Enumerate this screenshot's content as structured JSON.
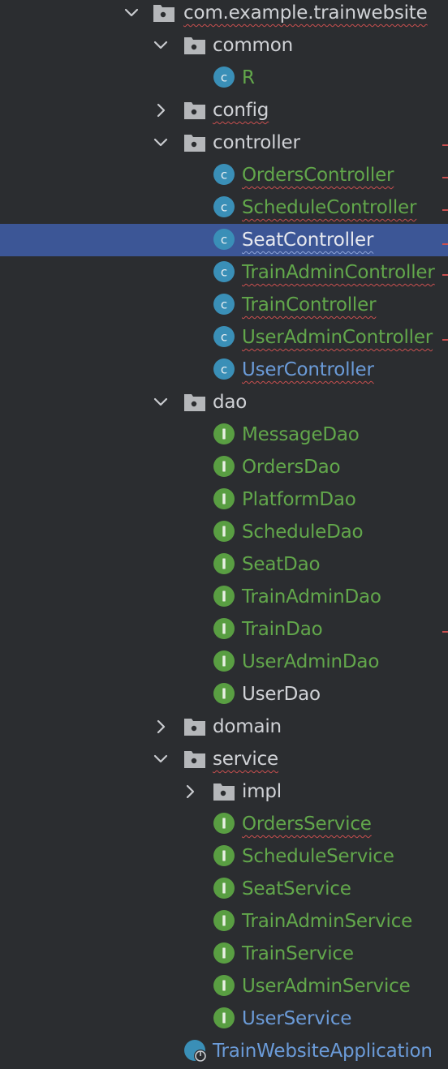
{
  "colors": {
    "background": "#2b2d30",
    "selection": "#3c5696",
    "text_default": "#d0d2d6",
    "text_modified": "#62a74b",
    "text_link": "#6b9bd8",
    "class_icon": "#3a8fb7",
    "interface_icon": "#599e42",
    "folder_icon": "#b5b7ba",
    "error_underline": "#c94f4f"
  },
  "tree": [
    {
      "label": "com.example.trainwebsite",
      "kind": "package",
      "expanded": true,
      "depth": 0,
      "color": "default",
      "underline": "error"
    },
    {
      "label": "common",
      "kind": "package",
      "expanded": true,
      "depth": 1,
      "color": "default"
    },
    {
      "label": "R",
      "kind": "class",
      "depth": 2,
      "color": "modified"
    },
    {
      "label": "config",
      "kind": "package",
      "expanded": false,
      "depth": 1,
      "color": "default",
      "underline": "error"
    },
    {
      "label": "controller",
      "kind": "package",
      "expanded": true,
      "depth": 1,
      "color": "default",
      "mark": true
    },
    {
      "label": "OrdersController",
      "kind": "class",
      "depth": 2,
      "color": "modified",
      "underline": "error",
      "mark": true
    },
    {
      "label": "ScheduleController",
      "kind": "class",
      "depth": 2,
      "color": "modified",
      "underline": "error",
      "mark": true
    },
    {
      "label": "SeatController",
      "kind": "class",
      "depth": 2,
      "color": "default",
      "underline": "selected",
      "selected": true,
      "mark": true
    },
    {
      "label": "TrainAdminController",
      "kind": "class",
      "depth": 2,
      "color": "modified",
      "underline": "error",
      "mark": true
    },
    {
      "label": "TrainController",
      "kind": "class",
      "depth": 2,
      "color": "modified",
      "underline": "error"
    },
    {
      "label": "UserAdminController",
      "kind": "class",
      "depth": 2,
      "color": "modified",
      "underline": "error",
      "mark": true
    },
    {
      "label": "UserController",
      "kind": "class",
      "depth": 2,
      "color": "link",
      "underline": "error"
    },
    {
      "label": "dao",
      "kind": "package",
      "expanded": true,
      "depth": 1,
      "color": "default"
    },
    {
      "label": "MessageDao",
      "kind": "interface",
      "depth": 2,
      "color": "modified"
    },
    {
      "label": "OrdersDao",
      "kind": "interface",
      "depth": 2,
      "color": "modified"
    },
    {
      "label": "PlatformDao",
      "kind": "interface",
      "depth": 2,
      "color": "modified"
    },
    {
      "label": "ScheduleDao",
      "kind": "interface",
      "depth": 2,
      "color": "modified"
    },
    {
      "label": "SeatDao",
      "kind": "interface",
      "depth": 2,
      "color": "modified"
    },
    {
      "label": "TrainAdminDao",
      "kind": "interface",
      "depth": 2,
      "color": "modified"
    },
    {
      "label": "TrainDao",
      "kind": "interface",
      "depth": 2,
      "color": "modified",
      "mark": true
    },
    {
      "label": "UserAdminDao",
      "kind": "interface",
      "depth": 2,
      "color": "modified"
    },
    {
      "label": "UserDao",
      "kind": "interface",
      "depth": 2,
      "color": "default"
    },
    {
      "label": "domain",
      "kind": "package",
      "expanded": false,
      "depth": 1,
      "color": "default"
    },
    {
      "label": "service",
      "kind": "package",
      "expanded": true,
      "depth": 1,
      "color": "default",
      "underline": "error"
    },
    {
      "label": "impl",
      "kind": "package",
      "expanded": false,
      "depth": 2,
      "color": "default"
    },
    {
      "label": "OrdersService",
      "kind": "interface",
      "depth": 2,
      "color": "modified",
      "underline": "error"
    },
    {
      "label": "ScheduleService",
      "kind": "interface",
      "depth": 2,
      "color": "modified"
    },
    {
      "label": "SeatService",
      "kind": "interface",
      "depth": 2,
      "color": "modified"
    },
    {
      "label": "TrainAdminService",
      "kind": "interface",
      "depth": 2,
      "color": "modified"
    },
    {
      "label": "TrainService",
      "kind": "interface",
      "depth": 2,
      "color": "modified"
    },
    {
      "label": "UserAdminService",
      "kind": "interface",
      "depth": 2,
      "color": "modified"
    },
    {
      "label": "UserService",
      "kind": "interface",
      "depth": 2,
      "color": "link"
    },
    {
      "label": "TrainWebsiteApplication",
      "kind": "spring-app",
      "depth": 1,
      "color": "link"
    }
  ]
}
